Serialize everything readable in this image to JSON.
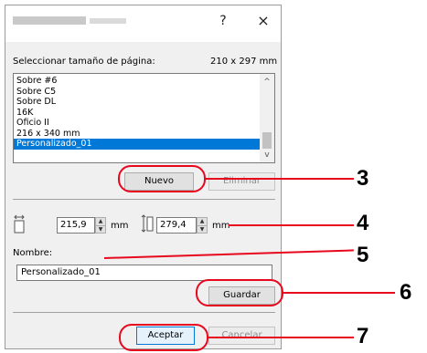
{
  "dialog": {
    "help_label": "?",
    "close_label": "×"
  },
  "page_size": {
    "label": "Seleccionar tamaño de página:",
    "current_size": "210 x 297 mm",
    "items": [
      "Sobre #6",
      "Sobre C5",
      "Sobre DL",
      "16K",
      "Oficio II",
      "216 x 340 mm",
      "Personalizado_01"
    ],
    "selected_index": 6,
    "scroll_up_glyph": "^",
    "scroll_down_glyph": "v"
  },
  "buttons": {
    "new_label": "Nuevo",
    "delete_label": "Eliminar",
    "save_label": "Guardar",
    "ok_label": "Aceptar",
    "cancel_label": "Cancelar"
  },
  "dimensions": {
    "width_value": "215,9",
    "width_unit": "mm",
    "height_value": "279,4",
    "height_unit": "mm",
    "width_icon": "width-arrow-icon",
    "height_icon": "height-arrow-icon"
  },
  "name": {
    "label": "Nombre:",
    "value": "Personalizado_01"
  },
  "callouts": {
    "color": "#e8081e",
    "numbers": [
      "3",
      "4",
      "5",
      "6",
      "7"
    ]
  }
}
